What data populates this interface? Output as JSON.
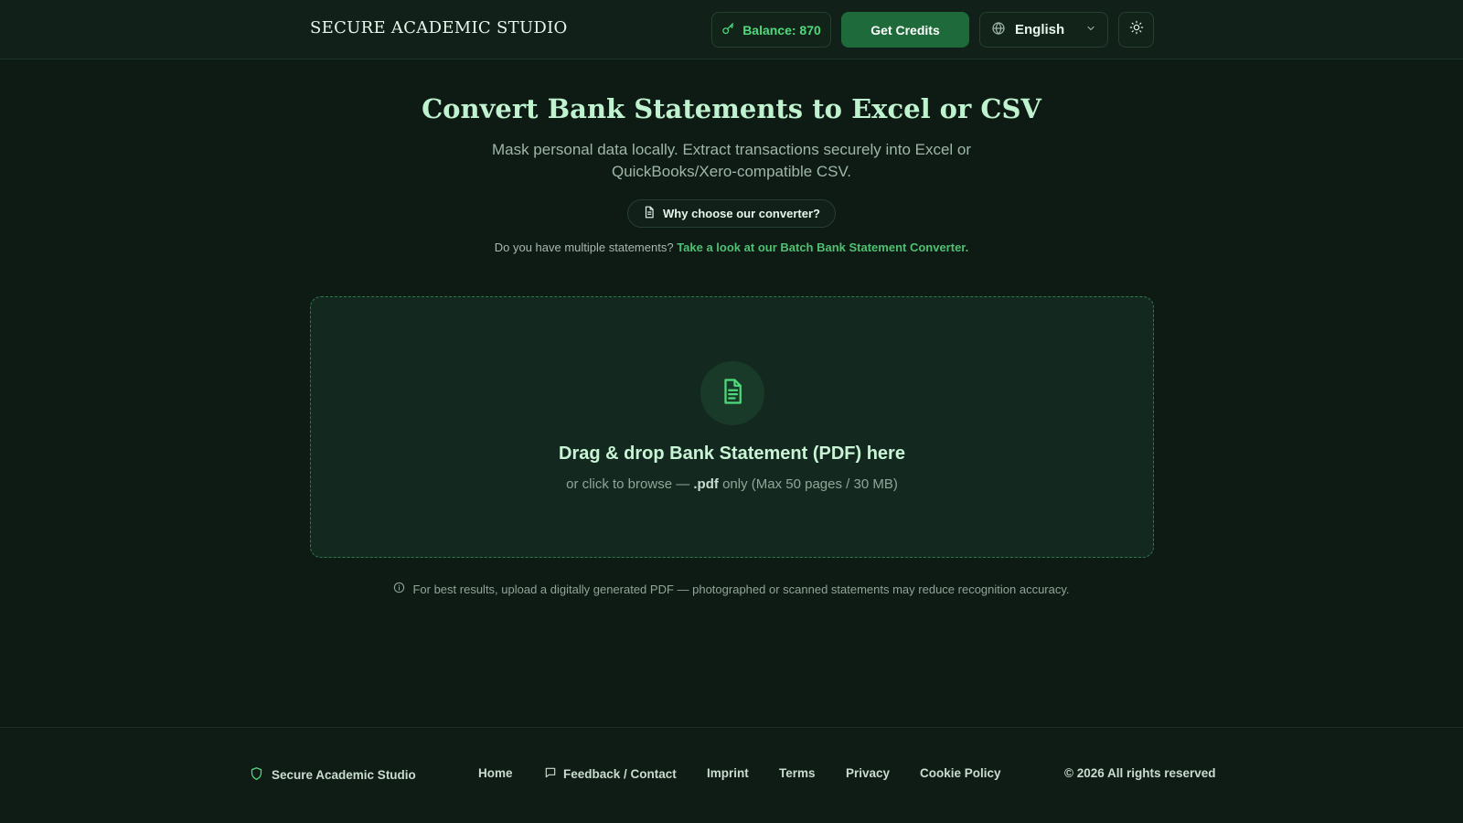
{
  "header": {
    "brand": "SECURE ACADEMIC STUDIO",
    "balance_label": "Balance: 870",
    "get_credits_label": "Get Credits",
    "language": "English"
  },
  "hero": {
    "title": "Convert Bank Statements to Excel or CSV",
    "subtitle": "Mask personal data locally. Extract transactions securely into Excel or QuickBooks/Xero-compatible CSV.",
    "why_button": "Why choose our converter?",
    "multi_question": "Do you have multiple statements?",
    "multi_link": "Take a look at our Batch Bank Statement Converter."
  },
  "dropzone": {
    "title": "Drag & drop Bank Statement (PDF) here",
    "sub_prefix": "or click to browse —",
    "sub_ext": ".pdf",
    "sub_suffix": "only (Max 50 pages / 30 MB)"
  },
  "tip": "For best results, upload a digitally generated PDF — photographed or scanned statements may reduce recognition accuracy.",
  "footer": {
    "brand": "Secure Academic Studio",
    "links": {
      "home": "Home",
      "feedback": "Feedback / Contact",
      "imprint": "Imprint",
      "terms": "Terms",
      "privacy": "Privacy",
      "cookie": "Cookie Policy"
    },
    "copyright": "© 2026 All rights reserved"
  },
  "colors": {
    "accent": "#4fd97c",
    "button": "#1f6a3a",
    "background": "#0e1a14",
    "link": "#4fc072"
  }
}
